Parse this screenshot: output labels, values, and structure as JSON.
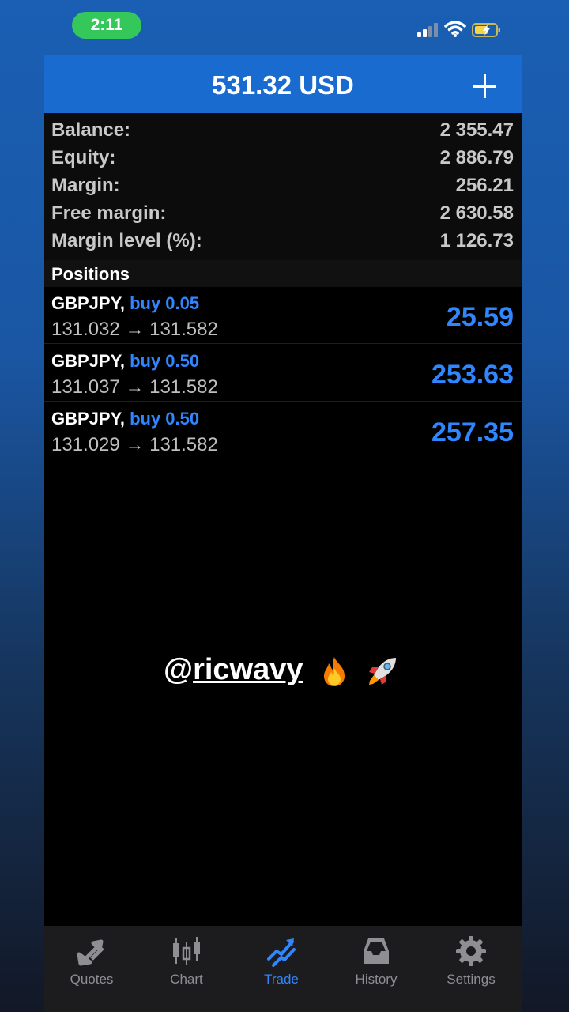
{
  "status_bar": {
    "time": "2:11"
  },
  "header": {
    "title": "531.32 USD",
    "add_icon": "plus-icon"
  },
  "summary": [
    {
      "label": "Balance:",
      "value": "2 355.47"
    },
    {
      "label": "Equity:",
      "value": "2 886.79"
    },
    {
      "label": "Margin:",
      "value": "256.21"
    },
    {
      "label": "Free margin:",
      "value": "2 630.58"
    },
    {
      "label": "Margin level (%):",
      "value": "1 126.73"
    }
  ],
  "positions": {
    "title": "Positions",
    "items": [
      {
        "symbol": "GBPJPY,",
        "side": "buy 0.05",
        "prices": "131.032 → 131.582",
        "profit": "25.59"
      },
      {
        "symbol": "GBPJPY,",
        "side": "buy 0.50",
        "prices": "131.037 → 131.582",
        "profit": "253.63"
      },
      {
        "symbol": "GBPJPY,",
        "side": "buy 0.50",
        "prices": "131.029 → 131.582",
        "profit": "257.35"
      }
    ]
  },
  "watermark": {
    "at": "@",
    "handle": "ricwavy",
    "emoji_1": "fire-emoji",
    "emoji_2": "rocket-emoji"
  },
  "tabs": [
    {
      "label": "Quotes",
      "icon": "quotes-arrows-icon"
    },
    {
      "label": "Chart",
      "icon": "candlestick-icon"
    },
    {
      "label": "Trade",
      "icon": "trade-trend-icon",
      "active": true
    },
    {
      "label": "History",
      "icon": "inbox-tray-icon"
    },
    {
      "label": "Settings",
      "icon": "gear-icon"
    }
  ],
  "colors": {
    "accent": "#2f86ff",
    "header_bg": "#1a6bd0",
    "time_pill": "#34c759"
  }
}
